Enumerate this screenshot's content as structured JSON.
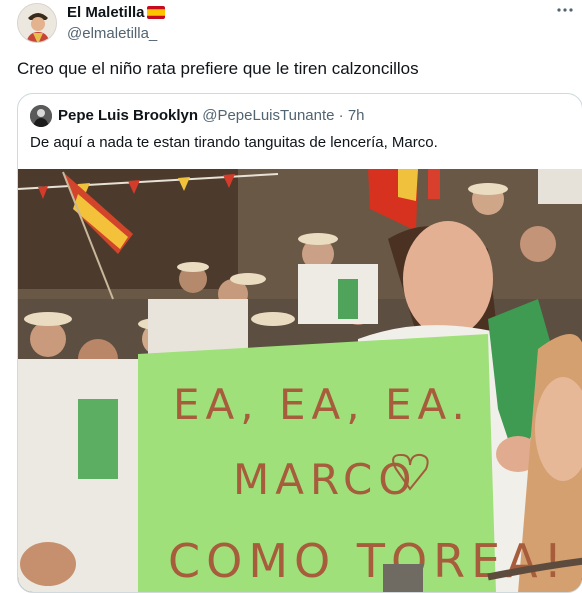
{
  "tweet": {
    "author_name": "El Maletilla",
    "author_handle": "@elmaletilla_",
    "text": "Creo que el niño rata prefiere que le tiren calzoncillos",
    "more_icon": "ellipsis-horizontal-icon"
  },
  "quoted_tweet": {
    "author_name": "Pepe Luis Brooklyn",
    "author_handle": "@PepeLuisTunante",
    "separator": "·",
    "time": "7h",
    "text": "De aquí a nada te estan tirando tanguitas de lencería, Marco.",
    "photo": {
      "sign_lines": [
        "EA, EA, EA.",
        "MARCO",
        "COMO TOREA!"
      ]
    }
  },
  "colors": {
    "text_primary": "#0f1419",
    "text_secondary": "#536471",
    "card_border": "#cfd9de",
    "sign_green": "#9fe07a"
  }
}
